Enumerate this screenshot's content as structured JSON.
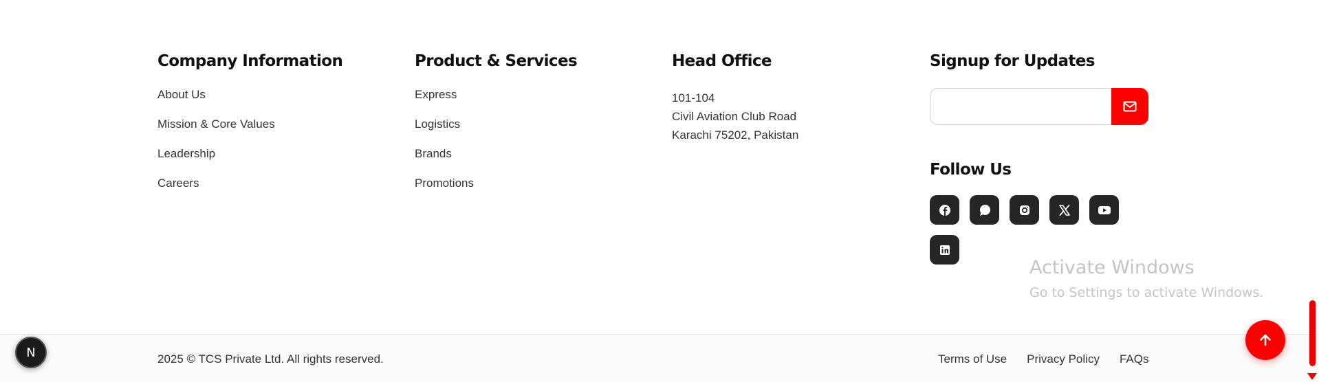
{
  "company": {
    "title": "Company Information",
    "links": [
      "About Us",
      "Mission & Core Values",
      "Leadership",
      "Careers"
    ]
  },
  "products": {
    "title": "Product & Services",
    "links": [
      "Express",
      "Logistics",
      "Brands",
      "Promotions"
    ]
  },
  "office": {
    "title": "Head Office",
    "address": [
      "101-104",
      "Civil Aviation Club Road",
      "Karachi 75202, Pakistan"
    ]
  },
  "signup": {
    "title": "Signup for Updates",
    "input_value": "",
    "placeholder": "",
    "button_icon": "mail-icon"
  },
  "follow": {
    "title": "Follow Us",
    "icons": [
      "facebook-icon",
      "whatsapp-icon",
      "instagram-icon",
      "x-icon",
      "youtube-icon",
      "linkedin-icon"
    ]
  },
  "watermark": {
    "title": "Activate Windows",
    "subtitle": "Go to Settings to activate Windows."
  },
  "bottom": {
    "copyright": "2025 © TCS Private Ltd. All rights reserved.",
    "links": [
      "Terms of Use",
      "Privacy Policy",
      "FAQs"
    ]
  },
  "nextjs_badge": {
    "letter": "N"
  },
  "colors": {
    "accent": "#ff0000",
    "social_bg": "#262626",
    "text": "#333333",
    "heading": "#111111"
  }
}
